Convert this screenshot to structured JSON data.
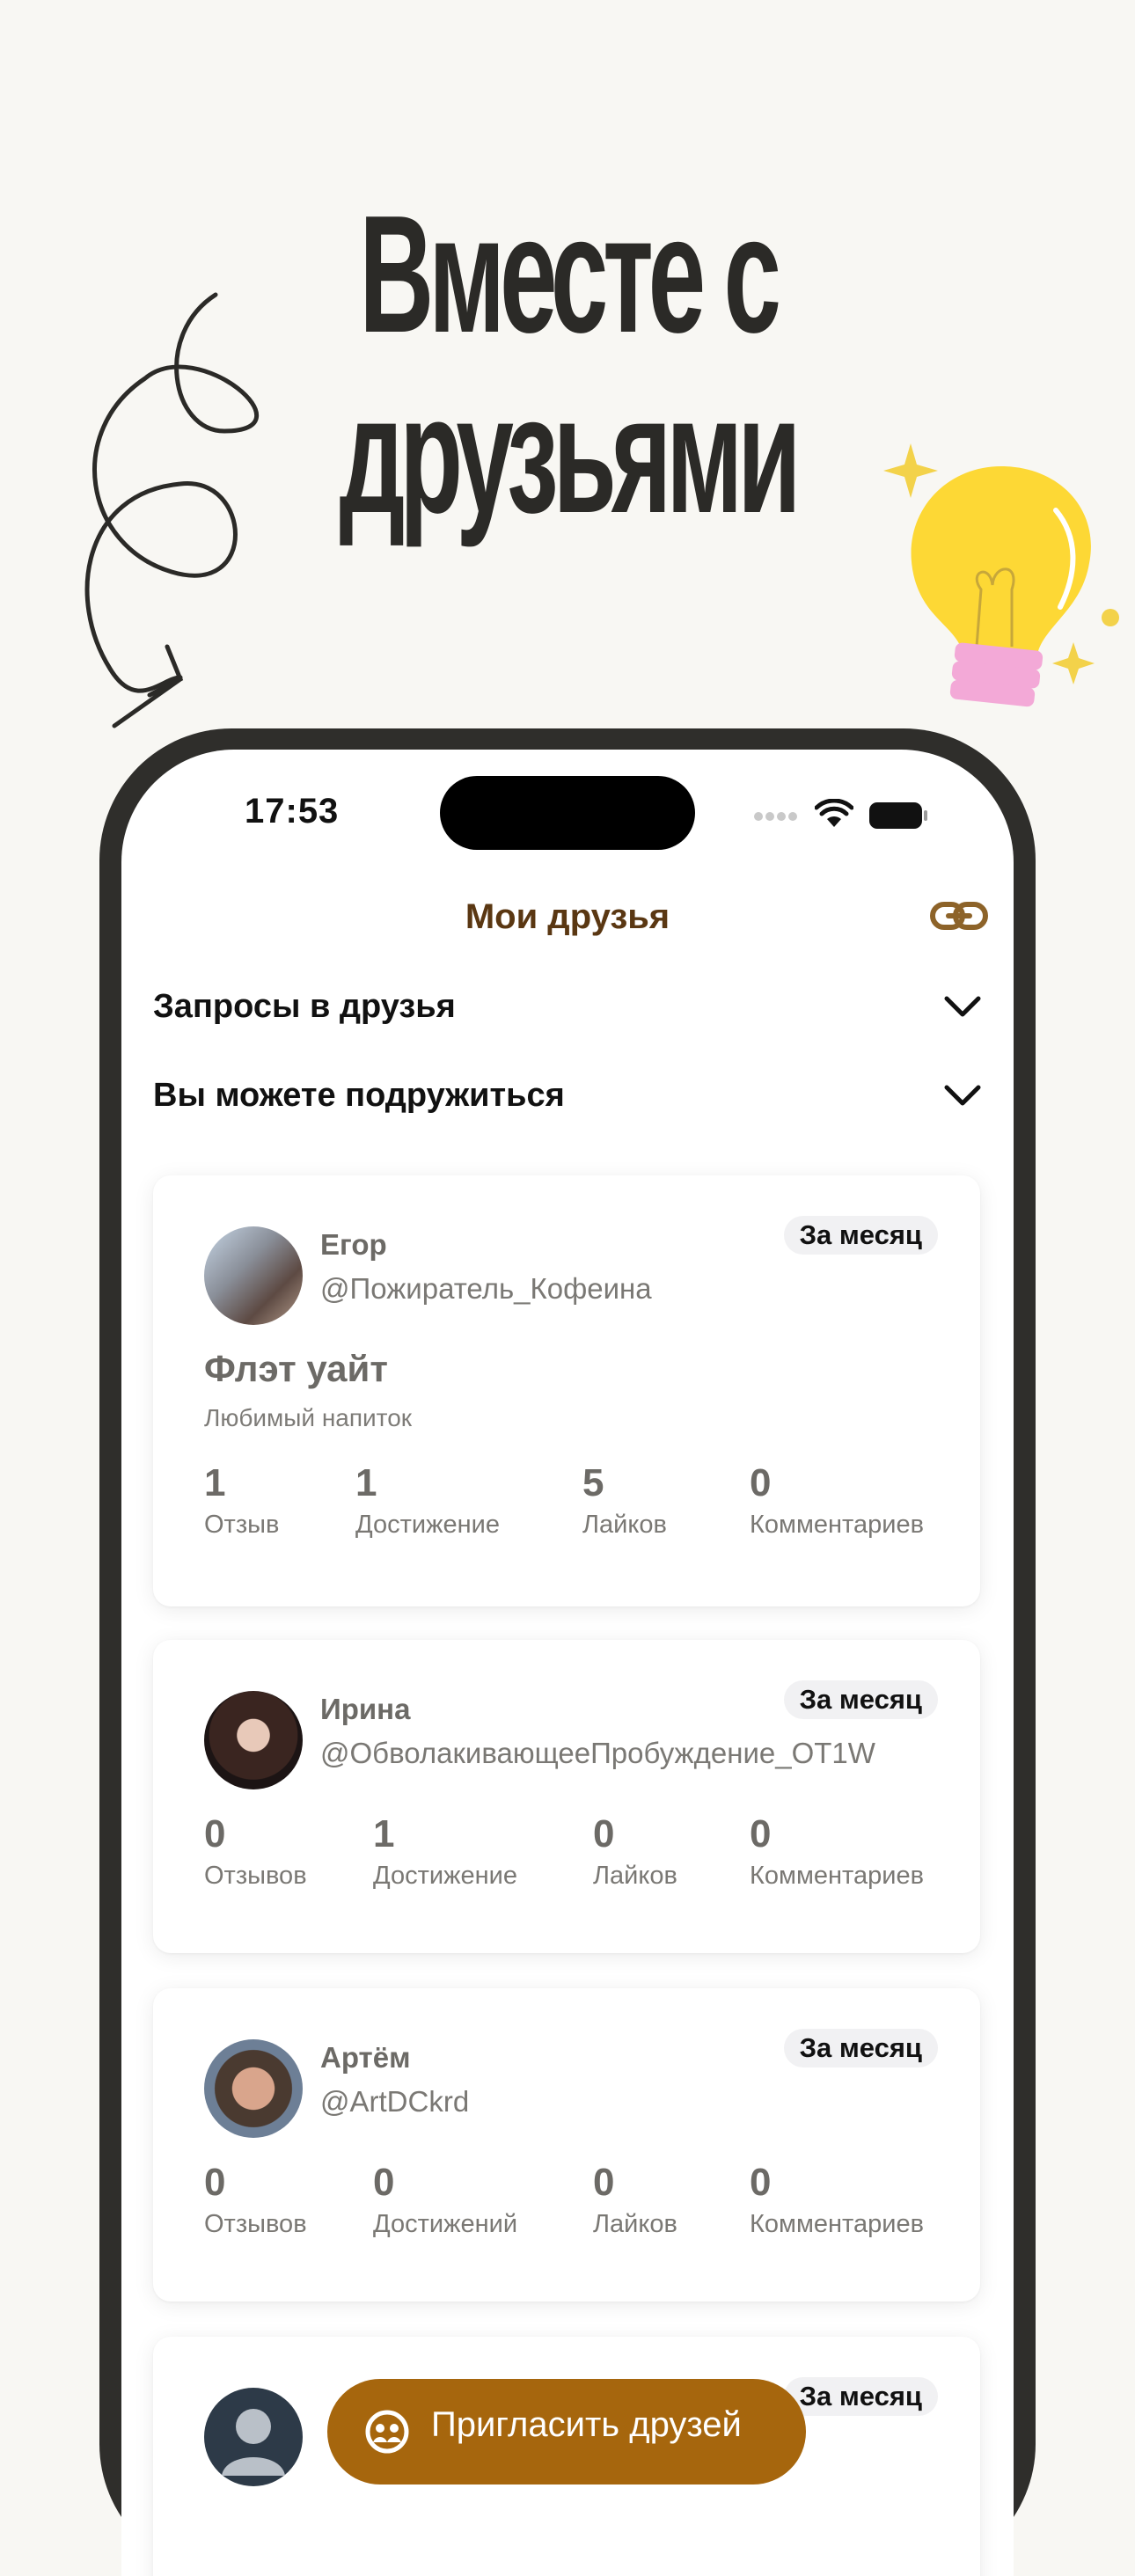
{
  "headline": {
    "line1": "Вместе с",
    "line2": "друзьями"
  },
  "status_bar": {
    "time": "17:53"
  },
  "nav": {
    "title": "Мои друзья",
    "share_icon": "link-icon"
  },
  "sections": {
    "requests": "Запросы в друзья",
    "suggestions": "Вы можете подружиться"
  },
  "period_badge": "За месяц",
  "friends": [
    {
      "name": "Егор",
      "handle": "@Пожиратель_Кофеина",
      "drink": "Флэт уайт",
      "drink_label": "Любимый напиток",
      "stats": [
        {
          "value": "1",
          "label": "Отзыв"
        },
        {
          "value": "1",
          "label": "Достижение"
        },
        {
          "value": "5",
          "label": "Лайков"
        },
        {
          "value": "0",
          "label": "Комментариев"
        }
      ]
    },
    {
      "name": "Ирина",
      "handle": "@ОбволакивающееПробуждение_OT1W",
      "stats": [
        {
          "value": "0",
          "label": "Отзывов"
        },
        {
          "value": "1",
          "label": "Достижение"
        },
        {
          "value": "0",
          "label": "Лайков"
        },
        {
          "value": "0",
          "label": "Комментариев"
        }
      ]
    },
    {
      "name": "Артём",
      "handle": "@ArtDCkrd",
      "stats": [
        {
          "value": "0",
          "label": "Отзывов"
        },
        {
          "value": "0",
          "label": "Достижений"
        },
        {
          "value": "0",
          "label": "Лайков"
        },
        {
          "value": "0",
          "label": "Комментариев"
        }
      ]
    }
  ],
  "invite_button": "Пригласить друзей",
  "colors": {
    "accent": "#a6660d",
    "title_brown": "#5a3712",
    "background": "#f8f7f3",
    "frame": "#2f2e2b"
  }
}
